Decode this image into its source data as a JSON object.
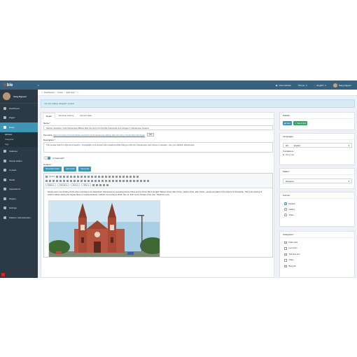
{
  "brand": {
    "logo_a": "b",
    "logo_b": "ble"
  },
  "topbar": {
    "collapse": "≡",
    "view_website": "View website",
    "theme": "Theme",
    "language": "English",
    "user": "Sang Nguyen"
  },
  "sidebar": {
    "user_name": "Sang Nguyen",
    "items": [
      {
        "label": "Dashboard"
      },
      {
        "label": "Pages"
      },
      {
        "label": "Posts"
      },
      {
        "label": "Galleries"
      },
      {
        "label": "Simple sliders"
      },
      {
        "label": "Contact"
      },
      {
        "label": "Media"
      },
      {
        "label": "Appearance"
      },
      {
        "label": "Plugins"
      },
      {
        "label": "Settings"
      },
      {
        "label": "Platform Administration"
      }
    ],
    "subitems": [
      {
        "label": "All Posts"
      },
      {
        "label": "Categories"
      },
      {
        "label": "Tags"
      }
    ]
  },
  "breadcrumb": {
    "home": "Dashboard",
    "sep": "/",
    "posts": "Posts",
    "edit": "Edit post \"…\""
  },
  "notice": "You are editing \"English\" version",
  "tabs": [
    "Detail",
    "Revision History",
    "Recent Note"
  ],
  "form": {
    "name_label": "Name",
    "name_value": "Vatican resolution: local Vietnamese Bishop after the story of a humble Franciscan and refugee in Vietnamese freedom",
    "permalink_label": "Permalink:",
    "permalink_url": "https://cms.ble.vn/news/vatican-resolution-local-vietnamese-bishop-after-the-story-of-a-humble-franciscan",
    "permalink_ok": "OK",
    "description_label": "Description",
    "description_value": "The people march to Olympic Freedom - a biography of a convert who preached while living to retire the Vietnamese man forever in despair - see you Catholic Vietnamese.",
    "featured_label": "Is Featured?",
    "content_label": "Content",
    "btn_editor": "Show/Hide Editor",
    "btn_media": "Add media",
    "btn_shortcode": "Shortcode",
    "editor_source": "Source",
    "editor_format": "Format",
    "editor_font": "Font",
    "editor_size": "Size",
    "editor_styles": "Styles",
    "editor_text": "People were now thinking Christ when returning to the fatherland: Vietnamese by spreading before Christ and by Christ. But in English: Before Christ, After Christ - before Christ, after Christ - people are affairs of the history of Christianity. This is the sharing of Luther's fathers during the regular Mass of medical students' Catholic community at 18:30, Nov 11, 2017 at the Temple of the vote. Thank the Lord."
  },
  "publish": {
    "title": "Publish",
    "save": "Save",
    "save_exit": "Save & Exit"
  },
  "languages": {
    "title": "Languages",
    "code": "EN",
    "value": "English",
    "translations_label": "Translations",
    "translation": "Tiếng Việt"
  },
  "status": {
    "title": "Status",
    "value": "Released"
  },
  "format": {
    "title": "Format",
    "options": [
      "Default",
      "Gallery",
      "Video"
    ],
    "selected": "Default"
  },
  "categories": {
    "title": "Categories",
    "items": [
      "Khám phá",
      "Lạ & Cool",
      "Thế thao trực",
      "Video",
      "Bóng đá"
    ]
  }
}
